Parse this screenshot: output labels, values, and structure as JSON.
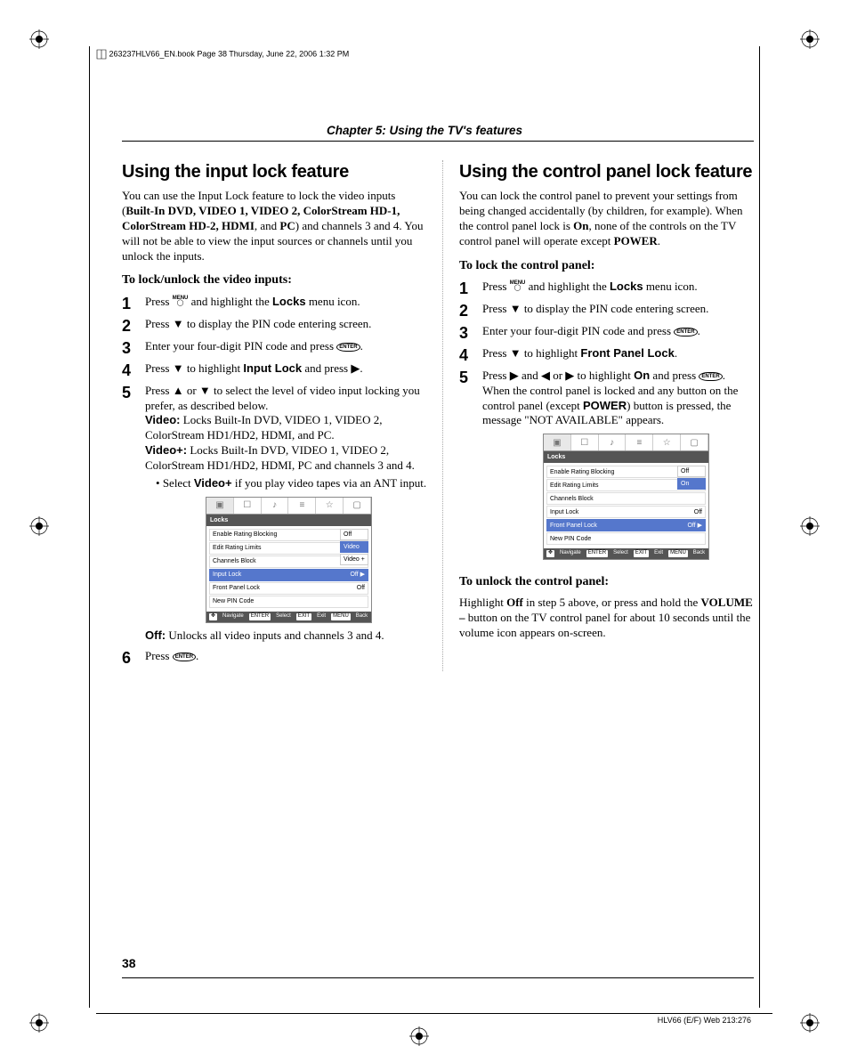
{
  "book_tag": "263237HLV66_EN.book  Page 38  Thursday, June 22, 2006  1:32 PM",
  "chapter_runner": "Chapter 5: Using the TV's features",
  "page_number": "38",
  "footer_right": "HLV66 (E/F) Web 213:276",
  "left": {
    "heading": "Using the input lock feature",
    "intro_pre": "You can use the Input Lock feature to lock the video inputs (",
    "intro_bold_list": "Built-In DVD, VIDEO 1, VIDEO 2, ColorStream HD-1, ColorStream HD-2, HDMI",
    "intro_mid": ", and ",
    "intro_pc": "PC",
    "intro_post": ") and channels 3 and 4. You will not be able to view the input sources or channels until you unlock the inputs.",
    "sub1": "To lock/unlock the video inputs:",
    "step1_a": "Press ",
    "step1_b": " and highlight the ",
    "step1_bold": "Locks",
    "step1_c": " menu icon.",
    "step2": "Press ▼ to display the PIN code entering screen.",
    "step3_a": "Enter your four-digit PIN code and press ",
    "step3_b": ".",
    "step4_a": "Press ▼ to highlight ",
    "step4_bold": "Input Lock",
    "step4_b": " and press ▶.",
    "step5_a": "Press ▲ or ▼ to select the level of video input locking you prefer, as described below.",
    "step5_video_lbl": "Video:",
    "step5_video": " Locks Built-In DVD, VIDEO 1, VIDEO 2, ColorStream HD1/HD2, HDMI, and PC.",
    "step5_videop_lbl": "Video+:",
    "step5_videop": " Locks Built-In DVD, VIDEO 1, VIDEO 2, ColorStream HD1/HD2, HDMI, PC and channels 3 and 4.",
    "step5_bullet_a": "Select ",
    "step5_bullet_bold": "Video+",
    "step5_bullet_b": " if you play video tapes via an ANT input.",
    "off_lbl": "Off:",
    "off_text": " Unlocks all video inputs and channels 3 and 4.",
    "step6_a": "Press ",
    "step6_b": ".",
    "osd": {
      "title": "Locks",
      "rows": [
        "Enable Rating Blocking",
        "Edit Rating Limits",
        "Channels Block",
        "Input Lock",
        "Front Panel Lock",
        "New PIN Code"
      ],
      "vals": [
        "Off",
        "",
        "",
        "Off   ▶",
        "Off",
        ""
      ],
      "side": [
        "Off",
        "Video",
        "Video +"
      ],
      "side_sel": 1,
      "hl_row": 3,
      "footer": [
        "Navigate",
        "Select",
        "Exit",
        "Back"
      ],
      "footer_keys": [
        "✥",
        "ENTER",
        "EXIT",
        "MENU"
      ]
    }
  },
  "right": {
    "heading": "Using the control panel lock feature",
    "intro_a": "You can lock the control panel to prevent your settings from being changed accidentally (by children, for example). When the control panel lock is ",
    "intro_on": "On",
    "intro_b": ", none of the controls on the TV control panel will operate except ",
    "intro_power": "POWER",
    "intro_c": ".",
    "sub1": "To lock the control panel:",
    "step1_a": "Press ",
    "step1_b": " and highlight the ",
    "step1_bold": "Locks",
    "step1_c": " menu icon.",
    "step2": "Press ▼ to display the PIN code entering screen.",
    "step3_a": "Enter your four-digit PIN code and press ",
    "step3_b": ".",
    "step4_a": "Press ▼ to highlight ",
    "step4_bold": "Front Panel Lock",
    "step4_b": ".",
    "step5_a": "Press ▶ and ◀ or ▶ to highlight ",
    "step5_on": "On",
    "step5_b": " and press ",
    "step5_c": ". When the control panel is locked and any button on the control panel (except ",
    "step5_power": "POWER",
    "step5_d": ") button is pressed, the message \"NOT AVAILABLE\" appears.",
    "sub2": "To unlock the control panel:",
    "unlock_a": "Highlight ",
    "unlock_off": "Off",
    "unlock_b": " in step 5 above, or press and hold the ",
    "unlock_vol": "VOLUME –",
    "unlock_c": " button on the TV control panel for about 10 seconds until the volume icon appears on-screen.",
    "osd": {
      "title": "Locks",
      "rows": [
        "Enable Rating Blocking",
        "Edit Rating Limits",
        "Channels Block",
        "Input Lock",
        "Front Panel Lock",
        "New PIN Code"
      ],
      "vals": [
        "Off",
        "",
        "",
        "Off",
        "Off   ▶",
        ""
      ],
      "side": [
        "Off",
        "On"
      ],
      "side_sel": 1,
      "hl_row": 4,
      "footer": [
        "Navigate",
        "Select",
        "Exit",
        "Back"
      ],
      "footer_keys": [
        "✥",
        "ENTER",
        "EXIT",
        "MENU"
      ]
    }
  }
}
